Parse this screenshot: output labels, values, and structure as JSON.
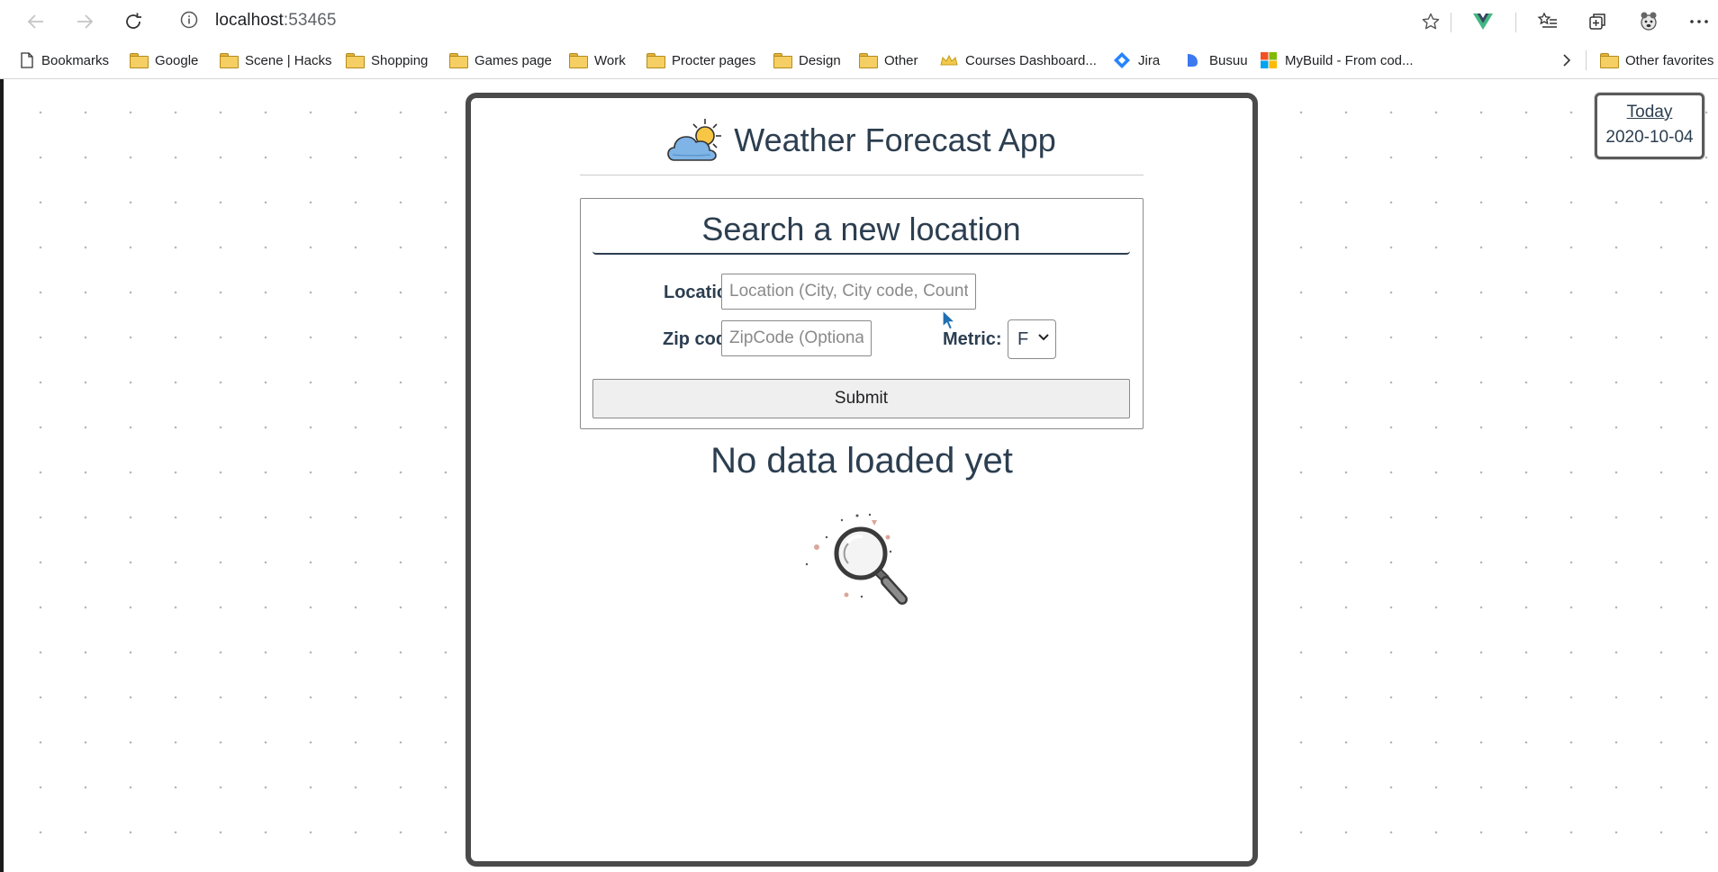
{
  "browser": {
    "address_host": "localhost",
    "address_port": ":53465",
    "bookmarks": [
      {
        "label": "Bookmarks",
        "icon": "page-icon"
      },
      {
        "label": "Google",
        "icon": "folder-icon"
      },
      {
        "label": "Scene | Hacks",
        "icon": "folder-icon"
      },
      {
        "label": "Shopping",
        "icon": "folder-icon"
      },
      {
        "label": "Games page",
        "icon": "folder-icon"
      },
      {
        "label": "Work",
        "icon": "folder-icon"
      },
      {
        "label": "Procter pages",
        "icon": "folder-icon"
      },
      {
        "label": "Design",
        "icon": "folder-icon"
      },
      {
        "label": "Other",
        "icon": "folder-icon"
      },
      {
        "label": "Courses Dashboard...",
        "icon": "crown-icon"
      },
      {
        "label": "Jira",
        "icon": "jira-icon"
      },
      {
        "label": "Busuu",
        "icon": "busuu-icon"
      },
      {
        "label": "MyBuild - From cod...",
        "icon": "microsoft-icon"
      }
    ],
    "other_favorites": "Other favorites"
  },
  "today": {
    "label": "Today",
    "date": "2020-10-04"
  },
  "app": {
    "title": "Weather Forecast App",
    "search": {
      "heading": "Search a new location",
      "location_label": "Location:",
      "location_placeholder": "Location (City, City code, Country)",
      "zip_label": "Zip code:",
      "zip_placeholder": "ZipCode (Optional)",
      "metric_label": "Metric:",
      "metric_value": "F",
      "submit_label": "Submit"
    },
    "empty_message": "No data loaded yet"
  },
  "colors": {
    "text": "#2c3e50",
    "card_border": "#4a4a4a",
    "button_bg": "#efefef"
  }
}
